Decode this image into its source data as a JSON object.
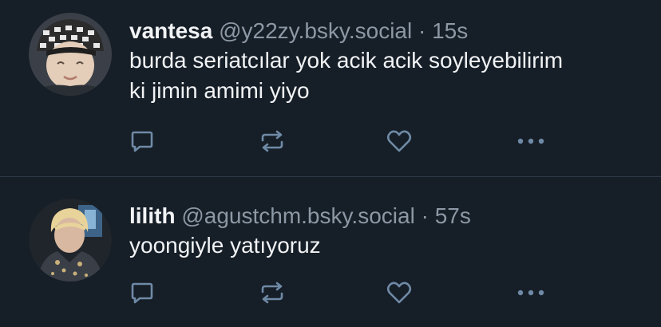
{
  "posts": [
    {
      "display_name": "vantesa",
      "handle": "@y22zy.bsky.social",
      "separator": "·",
      "time": "15s",
      "text": "burda seriatcılar yok acik acik soyleyebilirim ki jimin amimi yiyo"
    },
    {
      "display_name": "lilith",
      "handle": "@agustchm.bsky.social",
      "separator": "·",
      "time": "57s",
      "text": "yoongiyle yatıyoruz"
    }
  ],
  "icons": {
    "reply": "reply-icon",
    "repost": "repost-icon",
    "like": "like-icon",
    "more": "more-icon"
  },
  "colors": {
    "background": "#161e27",
    "text": "#f1f3f5",
    "muted": "#8d98a5",
    "icon": "#6f8aa6",
    "divider": "#2e3a48"
  }
}
